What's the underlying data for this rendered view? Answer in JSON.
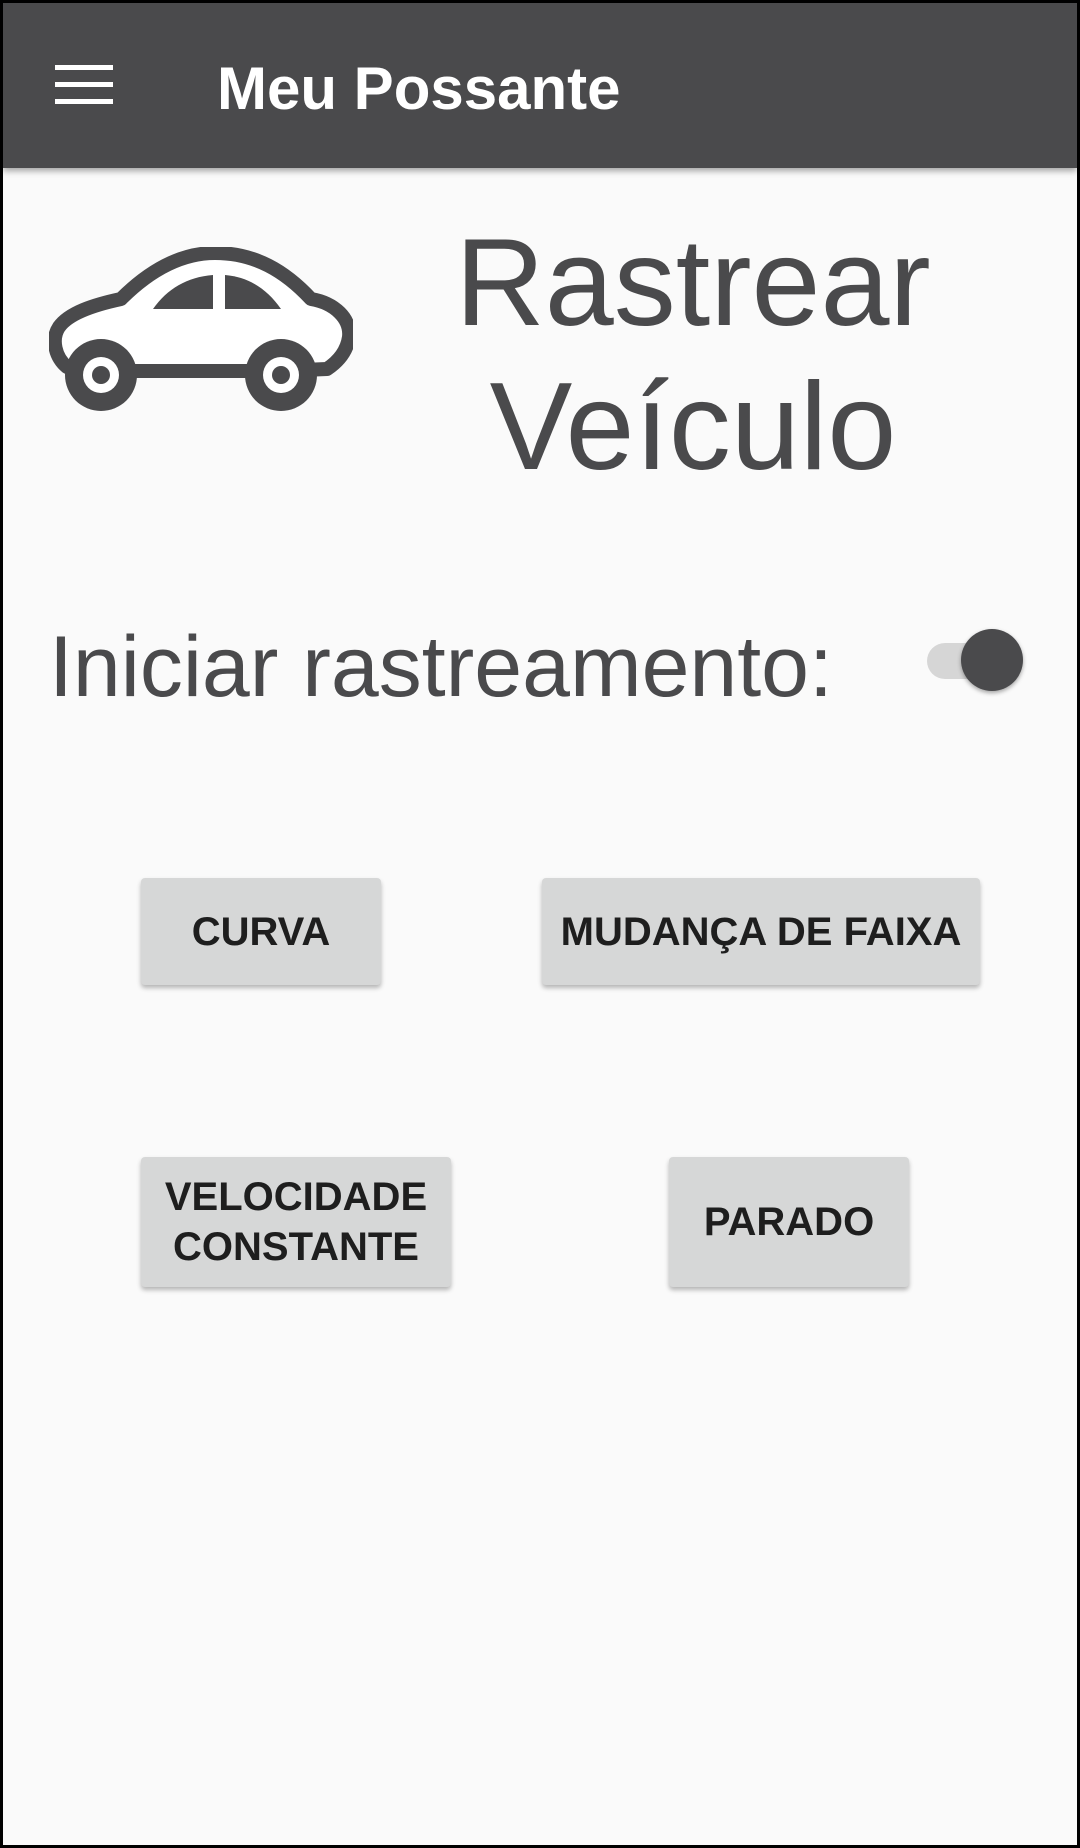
{
  "app_bar": {
    "menu_icon": "hamburger-menu-icon",
    "title": "Meu Possante",
    "background_color": "#4A4A4C"
  },
  "header": {
    "icon": "car-icon",
    "title_line1": "Rastrear",
    "title_line2": "Veículo"
  },
  "tracking": {
    "label": "Iniciar rastreamento:",
    "switch_on": true
  },
  "buttons": {
    "curva": "CURVA",
    "mudanca_de_faixa": "MUDANÇA DE FAIXA",
    "velocidade_constante_line1": "VELOCIDADE",
    "velocidade_constante_line2": "CONSTANTE",
    "parado": "PARADO"
  },
  "colors": {
    "text_primary": "#4A4A4C",
    "background": "#FAFAFA",
    "button": "#D6D7D7"
  }
}
